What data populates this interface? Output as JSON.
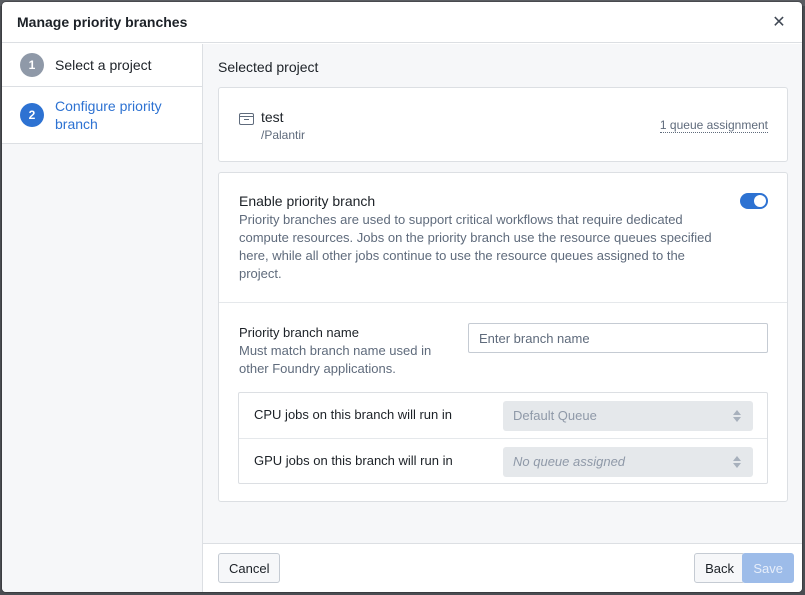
{
  "dialog": {
    "title": "Manage priority branches",
    "close_icon": "close-icon"
  },
  "steps": [
    {
      "number": "1",
      "label": "Select a project",
      "state": "complete"
    },
    {
      "number": "2",
      "label": "Configure priority branch",
      "state": "active"
    }
  ],
  "selected_project": {
    "section_label": "Selected project",
    "icon": "project-folder-icon",
    "name": "test",
    "path": "/Palantir",
    "queue_assignment_link": "1 queue assignment"
  },
  "priority_branch": {
    "enable_title": "Enable priority branch",
    "enable_description": "Priority branches are used to support critical workflows that require dedicated compute resources. Jobs on the priority branch use the resource queues specified here, while all other jobs continue to use the resource queues assigned to the project.",
    "enabled": true,
    "accent_color": "#2d72d2",
    "name_label": "Priority branch name",
    "name_help": "Must match branch name used in other Foundry applications.",
    "name_value": "",
    "name_placeholder": "Enter branch name"
  },
  "queues": [
    {
      "label": "CPU jobs on this branch will run in",
      "value": "Default Queue",
      "is_placeholder": false,
      "disabled": true
    },
    {
      "label": "GPU jobs on this branch will run in",
      "value": "No queue assigned",
      "is_placeholder": true,
      "disabled": true
    }
  ],
  "footer": {
    "cancel_label": "Cancel",
    "back_label": "Back",
    "save_label": "Save",
    "save_disabled": true
  }
}
